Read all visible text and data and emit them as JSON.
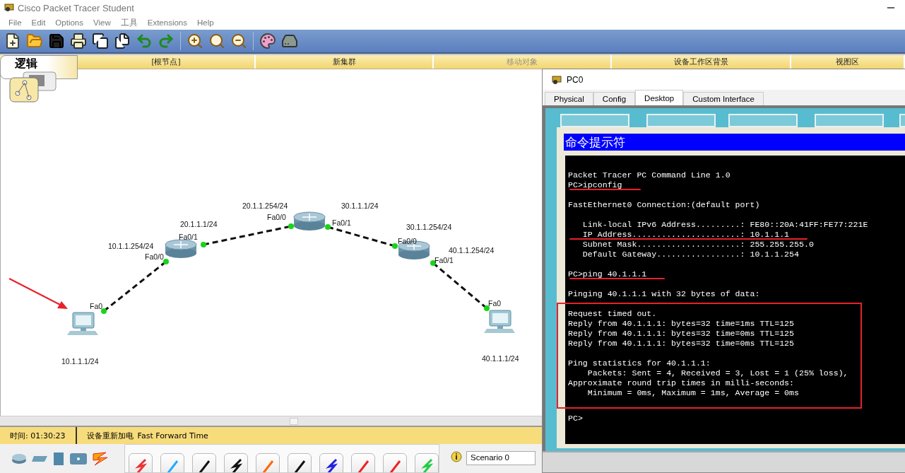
{
  "app_window": {
    "title": "Cisco Packet Tracer Student"
  },
  "menu": [
    "File",
    "Edit",
    "Options",
    "View",
    "工具",
    "Extensions",
    "Help"
  ],
  "workspace_bar": {
    "mode_tab": "逻辑",
    "items": [
      {
        "label": "[根节点]",
        "disabled": false
      },
      {
        "label": "新集群",
        "disabled": false
      },
      {
        "label": "移动对象",
        "disabled": true
      },
      {
        "label": "设备工作区背景",
        "disabled": false
      },
      {
        "label": "视图区",
        "disabled": false
      }
    ]
  },
  "diagram": {
    "devices": [
      {
        "kind": "pc",
        "address": "10.1.1.1/24"
      },
      {
        "kind": "router"
      },
      {
        "kind": "router"
      },
      {
        "kind": "router"
      },
      {
        "kind": "pc",
        "address": "40.1.1.1/24"
      }
    ],
    "links": [
      {
        "kind": "crossover",
        "ends": [
          {
            "port": "Fa0"
          },
          {
            "port": "Fa0/0",
            "address": "10.1.1.254/24"
          }
        ]
      },
      {
        "kind": "crossover",
        "ends": [
          {
            "port": "Fa0/1",
            "address": "20.1.1.1/24"
          },
          {
            "port": "Fa0/0",
            "address": "20.1.1.254/24"
          }
        ]
      },
      {
        "kind": "crossover",
        "ends": [
          {
            "port": "Fa0/1",
            "address": "30.1.1.1/24"
          },
          {
            "port": "Fa0/0",
            "address": "30.1.1.254/24"
          }
        ]
      },
      {
        "kind": "crossover",
        "ends": [
          {
            "port": "Fa0/1",
            "address": "40.1.1.254/24"
          },
          {
            "port": "Fa0"
          }
        ]
      }
    ]
  },
  "status_bar": {
    "time": "时间: 01:30:23",
    "power_cycle": "设备重新加电",
    "fast_forward": "Fast Forward Time"
  },
  "bottom_panel": {
    "scenario": "Scenario 0"
  },
  "pc_window": {
    "title": "PC0",
    "tabs": [
      {
        "label": "Physical",
        "selected": false
      },
      {
        "label": "Config",
        "selected": false
      },
      {
        "label": "Desktop",
        "selected": true
      },
      {
        "label": "Custom Interface",
        "selected": false
      }
    ],
    "command_prompt": {
      "title": "命令提示符",
      "blocks": [
        {
          "boxed": false,
          "lines": [
            {
              "text": "Packet Tracer PC Command Line 1.0",
              "underlined": false
            },
            {
              "text": "PC>ipconfig",
              "underlined": true
            }
          ]
        },
        {
          "boxed": false,
          "lines": [
            {
              "text": "FastEthernet0 Connection:(default port)",
              "underlined": false
            }
          ]
        },
        {
          "boxed": false,
          "lines": [
            {
              "text": "   Link-local IPv6 Address.........: FE80::20A:41FF:FE77:221E",
              "underlined": false
            },
            {
              "text": "   IP Address......................: 10.1.1.1",
              "underlined": true
            },
            {
              "text": "   Subnet Mask.....................: 255.255.255.0",
              "underlined": false
            },
            {
              "text": "   Default Gateway.................: 10.1.1.254",
              "underlined": false
            }
          ]
        },
        {
          "boxed": false,
          "lines": [
            {
              "text": "PC>ping 40.1.1.1",
              "underlined": true
            }
          ]
        },
        {
          "boxed": false,
          "lines": [
            {
              "text": "Pinging 40.1.1.1 with 32 bytes of data:",
              "underlined": false
            }
          ]
        },
        {
          "boxed": true,
          "lines": [
            {
              "text": "Request timed out.",
              "underlined": false
            },
            {
              "text": "Reply from 40.1.1.1: bytes=32 time=1ms TTL=125",
              "underlined": false
            },
            {
              "text": "Reply from 40.1.1.1: bytes=32 time=0ms TTL=125",
              "underlined": false
            },
            {
              "text": "Reply from 40.1.1.1: bytes=32 time=0ms TTL=125",
              "underlined": false
            }
          ]
        },
        {
          "boxed": true,
          "lines": [
            {
              "text": "Ping statistics for 40.1.1.1:",
              "underlined": false
            },
            {
              "text": "    Packets: Sent = 4, Received = 3, Lost = 1 (25% loss),",
              "underlined": false
            },
            {
              "text": "Approximate round trip times in milli-seconds:",
              "underlined": false
            },
            {
              "text": "    Minimum = 0ms, Maximum = 1ms, Average = 0ms",
              "underlined": false
            }
          ]
        },
        {
          "boxed": false,
          "lines": [
            {
              "text": "PC>",
              "underlined": false
            }
          ]
        }
      ]
    }
  }
}
